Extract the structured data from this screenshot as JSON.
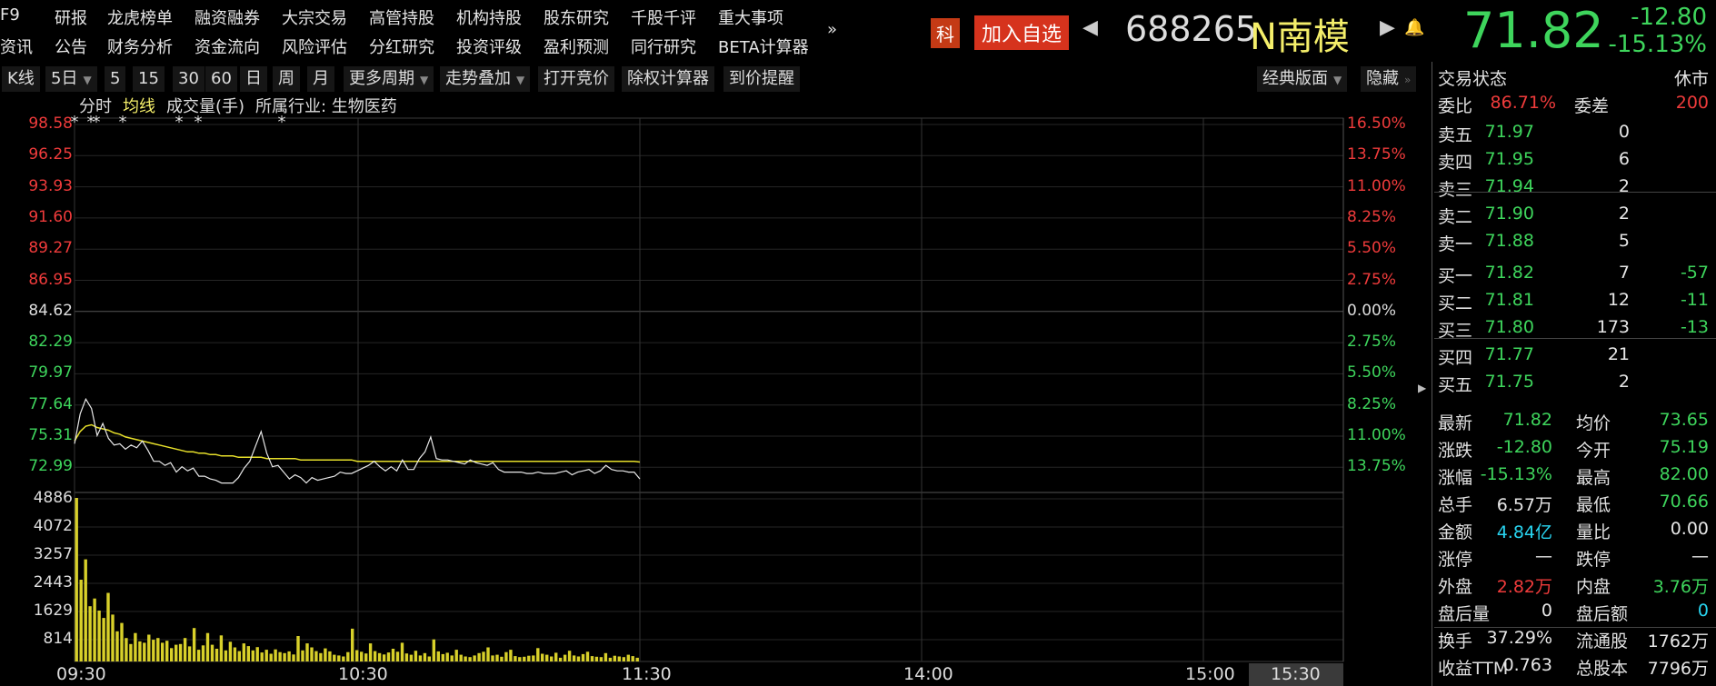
{
  "nav": {
    "row1": [
      "F9",
      "研报",
      "龙虎榜单",
      "融资融券",
      "大宗交易",
      "高管持股",
      "机构持股",
      "股东研究",
      "千股千评",
      "重大事项"
    ],
    "row2": [
      "资讯",
      "公告",
      "财务分析",
      "资金流向",
      "风险评估",
      "分红研究",
      "投资评级",
      "盈利预测",
      "同行研究",
      "BETA计算器"
    ],
    "more": "»"
  },
  "header": {
    "board_badge": "科",
    "add_watch": "加入自选",
    "code": "688265",
    "name": "N南模",
    "price": "71.82",
    "change": "-12.80",
    "change_pct": "-15.13%"
  },
  "toolbar": {
    "items": [
      "K线",
      "5日",
      "5",
      "15",
      "30",
      "60",
      "日",
      "周",
      "月",
      "更多周期",
      "走势叠加",
      "打开竞价",
      "除权计算器",
      "到价提醒"
    ],
    "right": [
      "经典版面",
      "隐藏"
    ]
  },
  "chart_bar": {
    "tab_minute": "分时",
    "tab_avg": "均线",
    "tab_volume": "成交量(手)",
    "industry": "所属行业: 生物医药"
  },
  "axes": {
    "price_left": [
      "98.58",
      "96.25",
      "93.93",
      "91.60",
      "89.27",
      "86.95",
      "84.62",
      "82.29",
      "79.97",
      "77.64",
      "75.31",
      "72.99"
    ],
    "pct_right": [
      "16.50%",
      "13.75%",
      "11.00%",
      "8.25%",
      "5.50%",
      "2.75%",
      "0.00%",
      "2.75%",
      "5.50%",
      "8.25%",
      "11.00%",
      "13.75%"
    ],
    "volume_left": [
      "4886",
      "4072",
      "3257",
      "2443",
      "1629",
      "814"
    ],
    "time": [
      "09:30",
      "10:30",
      "11:30",
      "14:00",
      "15:00",
      "15:30"
    ]
  },
  "chart_data": {
    "type": "line",
    "series": [
      {
        "name": "分时",
        "values": [
          75.0,
          77.2,
          78.3,
          77.6,
          75.6,
          76.5,
          75.4,
          74.9,
          75.0,
          74.6,
          74.9,
          74.7,
          75.2,
          74.5,
          73.7,
          73.7,
          73.4,
          73.6,
          72.9,
          73.3,
          73.0,
          73.2,
          72.6,
          72.6,
          72.4,
          72.3,
          72.1,
          72.1,
          72.1,
          72.5,
          73.2,
          73.7,
          74.8,
          75.9,
          74.3,
          73.3,
          73.4,
          72.9,
          72.4,
          72.7,
          72.5,
          72.1,
          72.5,
          72.3,
          72.4,
          72.5,
          72.6,
          72.9,
          72.8,
          72.8,
          73.0,
          73.2,
          73.4,
          73.7,
          73.3,
          73.0,
          73.3,
          73.0,
          73.8,
          73.1,
          73.1,
          73.9,
          74.4,
          75.5,
          73.9,
          73.8,
          73.8,
          73.7,
          73.6,
          73.5,
          73.8,
          73.6,
          73.5,
          73.4,
          73.6,
          73.1,
          72.9,
          72.9,
          72.9,
          72.9,
          72.8,
          72.8,
          72.9,
          72.8,
          72.8,
          72.8,
          72.9,
          73.0,
          72.7,
          72.9,
          73.0,
          73.1,
          72.8,
          73.0,
          73.4,
          73.1,
          73.0,
          73.0,
          72.9,
          72.9,
          72.4
        ]
      },
      {
        "name": "均线",
        "values": [
          75.2,
          75.9,
          76.3,
          76.4,
          76.2,
          76.1,
          76.0,
          75.8,
          75.7,
          75.5,
          75.4,
          75.3,
          75.2,
          75.1,
          75.0,
          74.9,
          74.8,
          74.7,
          74.6,
          74.5,
          74.4,
          74.4,
          74.3,
          74.3,
          74.2,
          74.2,
          74.1,
          74.1,
          74.1,
          74.0,
          74.0,
          74.0,
          74.0,
          74.0,
          73.9,
          73.9,
          73.9,
          73.9,
          73.9,
          73.9,
          73.8,
          73.8,
          73.8,
          73.8,
          73.8,
          73.8,
          73.8,
          73.8,
          73.8,
          73.8,
          73.7,
          73.7,
          73.7,
          73.7,
          73.7,
          73.7,
          73.7,
          73.7,
          73.7,
          73.7,
          73.7,
          73.7,
          73.7,
          73.7,
          73.7,
          73.7,
          73.7,
          73.7,
          73.7,
          73.7,
          73.7,
          73.7,
          73.7,
          73.7,
          73.7,
          73.7,
          73.7,
          73.7,
          73.7,
          73.7,
          73.7,
          73.7,
          73.7,
          73.7,
          73.7,
          73.7,
          73.7,
          73.7,
          73.7,
          73.7,
          73.7,
          73.7,
          73.7,
          73.7,
          73.7,
          73.7,
          73.7,
          73.7,
          73.7,
          73.7,
          73.65
        ]
      }
    ],
    "volume": [
      4886,
      2443,
      3050,
      1650,
      1880,
      1520,
      1300,
      2050,
      1400,
      900,
      1150,
      700,
      520,
      850,
      600,
      560,
      800,
      650,
      700,
      560,
      620,
      400,
      500,
      520,
      700,
      450,
      1000,
      350,
      480,
      850,
      500,
      380,
      780,
      330,
      590,
      420,
      310,
      540,
      460,
      330,
      430,
      270,
      350,
      230,
      360,
      280,
      250,
      300,
      210,
      760,
      330,
      540,
      420,
      310,
      250,
      390,
      300,
      200,
      180,
      150,
      280,
      980,
      340,
      290,
      240,
      540,
      310,
      250,
      210,
      270,
      380,
      290,
      560,
      240,
      200,
      320,
      180,
      250,
      150,
      660,
      300,
      220,
      260,
      180,
      350,
      200,
      150,
      130,
      180,
      250,
      290,
      420,
      180,
      200,
      140,
      280,
      350,
      160,
      130,
      140,
      170,
      180,
      400,
      230,
      200,
      150,
      260,
      110,
      200,
      320,
      180,
      150,
      220,
      290,
      160,
      140,
      130,
      250,
      110,
      170,
      150,
      130,
      200,
      160,
      110
    ],
    "ylim": [
      70.66,
      98.58
    ],
    "volume_max": 4886,
    "sessions": [
      "09:30",
      "10:30",
      "11:30",
      "14:00",
      "15:00"
    ],
    "markers": "*"
  },
  "panel": {
    "status_label": "交易状态",
    "status_value": "休市",
    "wb_label": "委比",
    "wb_value": "86.71%",
    "wc_label": "委差",
    "wc_value": "200",
    "asks": [
      {
        "label": "卖五",
        "price": "71.97",
        "vol": "0"
      },
      {
        "label": "卖四",
        "price": "71.95",
        "vol": "6"
      },
      {
        "label": "卖三",
        "price": "71.94",
        "vol": "2"
      },
      {
        "label": "卖二",
        "price": "71.90",
        "vol": "2"
      },
      {
        "label": "卖一",
        "price": "71.88",
        "vol": "5"
      }
    ],
    "bids": [
      {
        "label": "买一",
        "price": "71.82",
        "vol": "7",
        "delta": "-57"
      },
      {
        "label": "买二",
        "price": "71.81",
        "vol": "12",
        "delta": "-11"
      },
      {
        "label": "买三",
        "price": "71.80",
        "vol": "173",
        "delta": "-13"
      },
      {
        "label": "买四",
        "price": "71.77",
        "vol": "21",
        "delta": ""
      },
      {
        "label": "买五",
        "price": "71.75",
        "vol": "2",
        "delta": ""
      }
    ],
    "stats": [
      [
        "最新",
        "71.82",
        "g",
        "均价",
        "73.65",
        "g"
      ],
      [
        "涨跌",
        "-12.80",
        "g",
        "今开",
        "75.19",
        "g"
      ],
      [
        "涨幅",
        "-15.13%",
        "g",
        "最高",
        "82.00",
        "g"
      ],
      [
        "总手",
        "6.57万",
        "w",
        "最低",
        "70.66",
        "g"
      ],
      [
        "金额",
        "4.84亿",
        "c",
        "量比",
        "0.00",
        "w"
      ],
      [
        "涨停",
        "—",
        "w",
        "跌停",
        "—",
        "w"
      ],
      [
        "外盘",
        "2.82万",
        "r",
        "内盘",
        "3.76万",
        "g"
      ],
      [
        "盘后量",
        "0",
        "w",
        "盘后额",
        "0",
        "c"
      ],
      [
        "换手",
        "37.29%",
        "w",
        "流通股",
        "1762万",
        "w"
      ],
      [
        "收益TTM",
        "0.763",
        "w",
        "总股本",
        "7796万",
        "w"
      ]
    ]
  }
}
